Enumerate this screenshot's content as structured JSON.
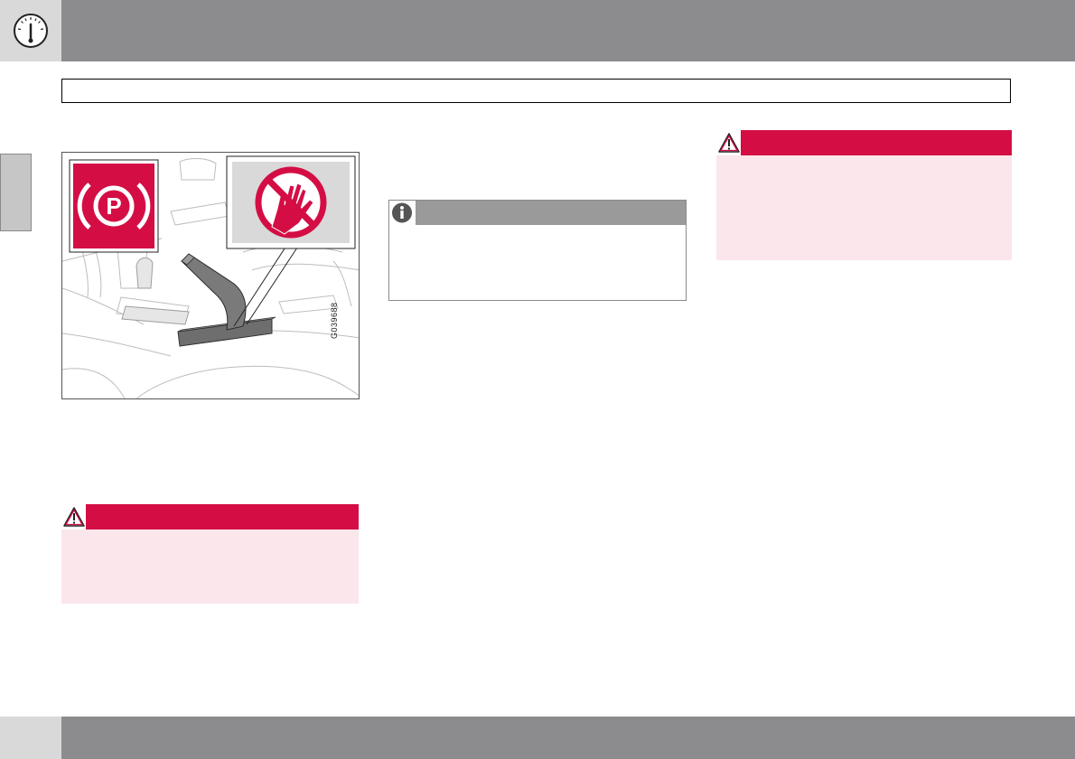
{
  "header": {
    "icon": "speedometer-gauge-icon",
    "section_title": ""
  },
  "illustration": {
    "figure_code": "G039688",
    "icons": [
      "parking-brake-symbol-icon",
      "no-hand-prohibition-icon"
    ]
  },
  "warning_left": {
    "icon": "warning-triangle-icon",
    "text": ""
  },
  "warning_right": {
    "icon": "warning-triangle-icon",
    "text": ""
  },
  "info_note": {
    "icon": "info-icon",
    "text": ""
  },
  "colors": {
    "header_gray": "#8c8c8e",
    "warning_red": "#d40e45",
    "warning_pink": "#fbe6ec",
    "info_gray": "#9a9a9a"
  }
}
